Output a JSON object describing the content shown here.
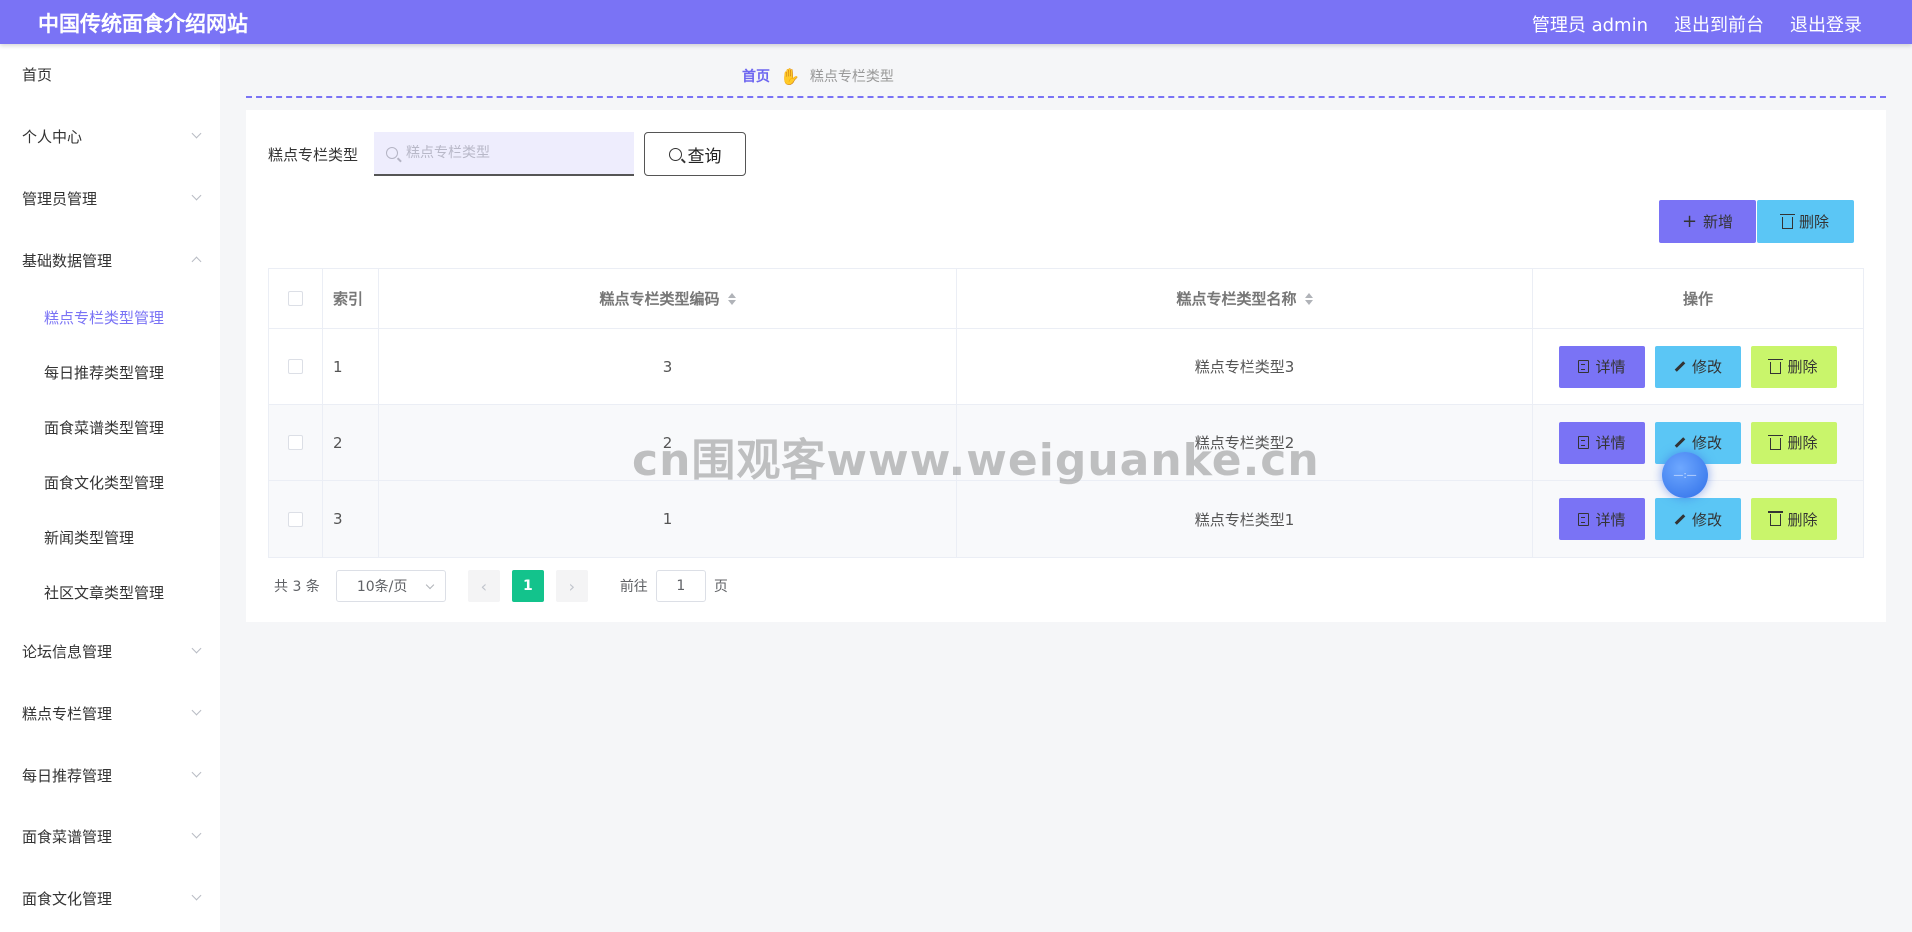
{
  "header": {
    "title": "中国传统面食介绍网站",
    "user": "管理员 admin",
    "to_front": "退出到前台",
    "logout": "退出登录"
  },
  "sidebar": {
    "items": [
      {
        "label": "首页"
      },
      {
        "label": "个人中心"
      },
      {
        "label": "管理员管理"
      },
      {
        "label": "基础数据管理"
      },
      {
        "label": "糕点专栏类型管理"
      },
      {
        "label": "每日推荐类型管理"
      },
      {
        "label": "面食菜谱类型管理"
      },
      {
        "label": "面食文化类型管理"
      },
      {
        "label": "新闻类型管理"
      },
      {
        "label": "社区文章类型管理"
      },
      {
        "label": "论坛信息管理"
      },
      {
        "label": "糕点专栏管理"
      },
      {
        "label": "每日推荐管理"
      },
      {
        "label": "面食菜谱管理"
      },
      {
        "label": "面食文化管理"
      }
    ]
  },
  "breadcrumb": {
    "home": "首页",
    "current": "糕点专栏类型"
  },
  "search": {
    "label": "糕点专栏类型",
    "placeholder": "糕点专栏类型",
    "value": "",
    "button": "查询"
  },
  "actions": {
    "add": "新增",
    "delete": "删除"
  },
  "table": {
    "headers": {
      "index": "索引",
      "code": "糕点专栏类型编码",
      "name": "糕点专栏类型名称",
      "ops": "操作"
    },
    "rows": [
      {
        "index": "1",
        "code": "3",
        "name": "糕点专栏类型3"
      },
      {
        "index": "2",
        "code": "2",
        "name": "糕点专栏类型2"
      },
      {
        "index": "3",
        "code": "1",
        "name": "糕点专栏类型1"
      }
    ],
    "ops": {
      "detail": "详情",
      "edit": "修改",
      "delete": "删除"
    }
  },
  "pagination": {
    "total": "共 3 条",
    "page_size": "10条/页",
    "current_page": "1",
    "goto_label": "前往",
    "goto_value": "1",
    "page_suffix": "页"
  },
  "watermark": "cn围观客www.weiguanke.cn",
  "colors": {
    "accent": "#7a73f5",
    "edit": "#5bc6f5",
    "delete": "#c9f56b",
    "page_active": "#13c38c"
  }
}
